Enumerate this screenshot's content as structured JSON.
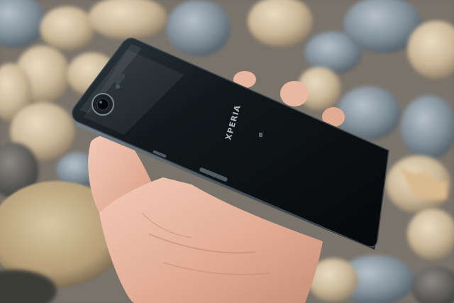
{
  "photo": {
    "subject": "phone-on-hand",
    "phone_brand_mark": "XPERIA",
    "colors": {
      "phone_body": "#0d1012",
      "phone_glass_highlight": "#3b4952",
      "phone_frame": "#5a646c",
      "skin": "#e8b8a2",
      "skin_shadow": "#c98f78",
      "pebble_warm": "#cdbb9f",
      "pebble_cool": "#7f8d97",
      "pebble_dark": "#4d4f4f"
    }
  }
}
